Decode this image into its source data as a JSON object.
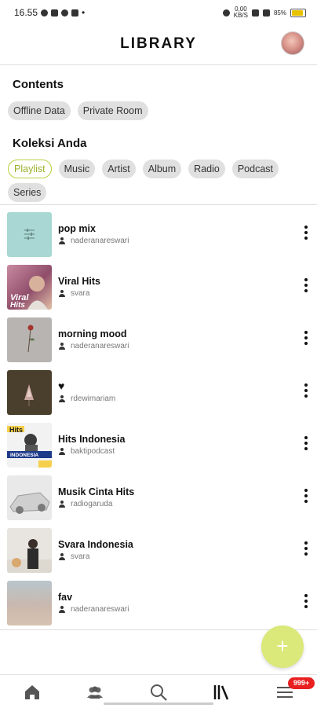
{
  "status_bar": {
    "time": "16.55",
    "net_speed": "0,00",
    "net_unit": "KB/S",
    "battery": "85%"
  },
  "header": {
    "title": "LIBRARY"
  },
  "contents": {
    "title": "Contents",
    "chips": [
      "Offline Data",
      "Private Room"
    ]
  },
  "collection": {
    "title": "Koleksi Anda",
    "chips": [
      "Playlist",
      "Music",
      "Artist",
      "Album",
      "Radio",
      "Podcast",
      "Series"
    ],
    "active": "Playlist"
  },
  "items": [
    {
      "title": "pop mix",
      "owner": "naderanareswari"
    },
    {
      "title": "Viral Hits",
      "owner": "svara"
    },
    {
      "title": "morning mood",
      "owner": "naderanareswari"
    },
    {
      "title": "♥",
      "owner": "rdewimariam"
    },
    {
      "title": "Hits Indonesia",
      "owner": "baktipodcast"
    },
    {
      "title": "Musik Cinta Hits",
      "owner": "radiogaruda"
    },
    {
      "title": "Svara Indonesia",
      "owner": "svara"
    },
    {
      "title": "fav",
      "owner": "naderanareswari"
    }
  ],
  "fab": {
    "label": "+"
  },
  "nav": {
    "items": [
      "home-icon",
      "community-icon",
      "search-icon",
      "library-icon",
      "menu-icon"
    ],
    "badge": "999+"
  }
}
